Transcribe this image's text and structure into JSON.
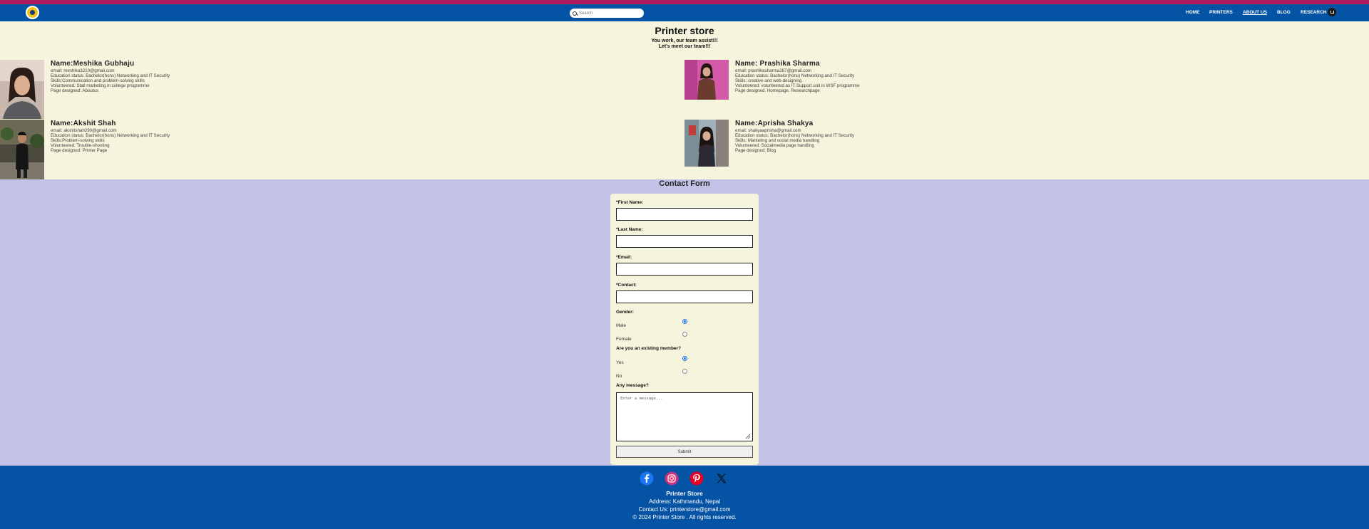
{
  "nav": {
    "search_placeholder": "Search",
    "links": [
      "HOME",
      "PRINTERS",
      "ABOUT US",
      "BLOG",
      "RESEARCH"
    ],
    "active": "ABOUT US"
  },
  "about": {
    "title": "Printer store",
    "subtitle1": "You work, our team assist!!!",
    "subtitle2": "Let's meet our team!!!",
    "members": [
      {
        "name": "Name:Meshika Gubhaju",
        "email": "email: meshika3210@gmail.com",
        "education": "Education status: Bachelor(hons) Networking and IT Security",
        "skills": "Skills:Communication and problem-solving skills",
        "volunteered": "Volunteered: Stall marketing in college programme",
        "page": "Page designed: Aboutus"
      },
      {
        "name": "Name: Prashika Sharma",
        "email": "email: prashikasharma287@gmail.com",
        "education": "Education status: Bachelor(hons) Networking and IT Security",
        "skills": "Skills: creative and web-designing",
        "volunteered": "Volunteered: volunteered as IT Support unit in WSF programme",
        "page": "Page designed: Homepage, Researchpage"
      },
      {
        "name": "Name:Akshit Shah",
        "email": "email: akshitshah290@gmail.com",
        "education": "Education status: Bachelor(hons) Networking and IT Security",
        "skills": "Skills:Problem-solving skills",
        "volunteered": "Volunteered: Trouble-shooting",
        "page": "Page designed: Printer Page"
      },
      {
        "name": "Name:Aprisha Shakya",
        "email": "email: shakyaaprisha@gmail.com",
        "education": "Education status: Bachelor(hons) Networking and IT Security",
        "skills": "Skills: Marketing and social media handling",
        "volunteered": "Volunteered: Socialmedia page handling",
        "page": "Page designed: Blog"
      }
    ]
  },
  "contact": {
    "title": "Contact Form",
    "first_name_label": "*First Name:",
    "last_name_label": "*Last Name:",
    "email_label": "*Email:",
    "contact_label": "*Contact:",
    "gender_label": "Gender:",
    "gender_male": "Male",
    "gender_female": "Female",
    "member_label": "Are you an existing member?",
    "member_yes": "Yes",
    "member_no": "No",
    "message_label": "Any message?",
    "message_placeholder": "Enter a message...",
    "submit_label": "Submit"
  },
  "footer": {
    "social_icons": [
      "facebook-icon",
      "instagram-icon",
      "pinterest-icon",
      "x-icon"
    ],
    "name": "Printer Store",
    "address": "Address: Kathmandu, Nepal",
    "contact": "Contact Us: printerstore@gmail.com",
    "copyright": "© 2024 Printer Store . All rights reserved."
  },
  "colors": {
    "nav_bg": "#0553a4",
    "top_strip": "#b0195e",
    "about_bg": "#f5f4dc",
    "contact_bg": "#c3c1e6"
  }
}
